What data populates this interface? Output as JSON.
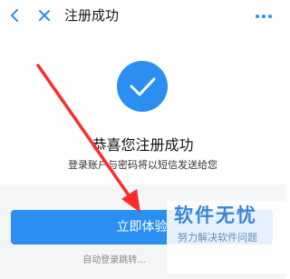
{
  "navbar": {
    "title": "注册成功",
    "back_icon": "chevron-left-icon",
    "close_icon": "close-icon",
    "more_icon": "more-dots-icon"
  },
  "success": {
    "icon": "check-icon",
    "headline": "恭喜您注册成功",
    "subline": "登录账户与密码将以短信发送给您"
  },
  "actions": {
    "primary_label": "立即体验",
    "auto_login_text": "自动登录跳转..."
  },
  "watermark": {
    "main": "软件无忧",
    "sub": "努力解决软件问题"
  },
  "colors": {
    "accent": "#2a8ff0",
    "annotation_arrow": "#ff2b2b",
    "lower_background": "#f4f5f7"
  }
}
